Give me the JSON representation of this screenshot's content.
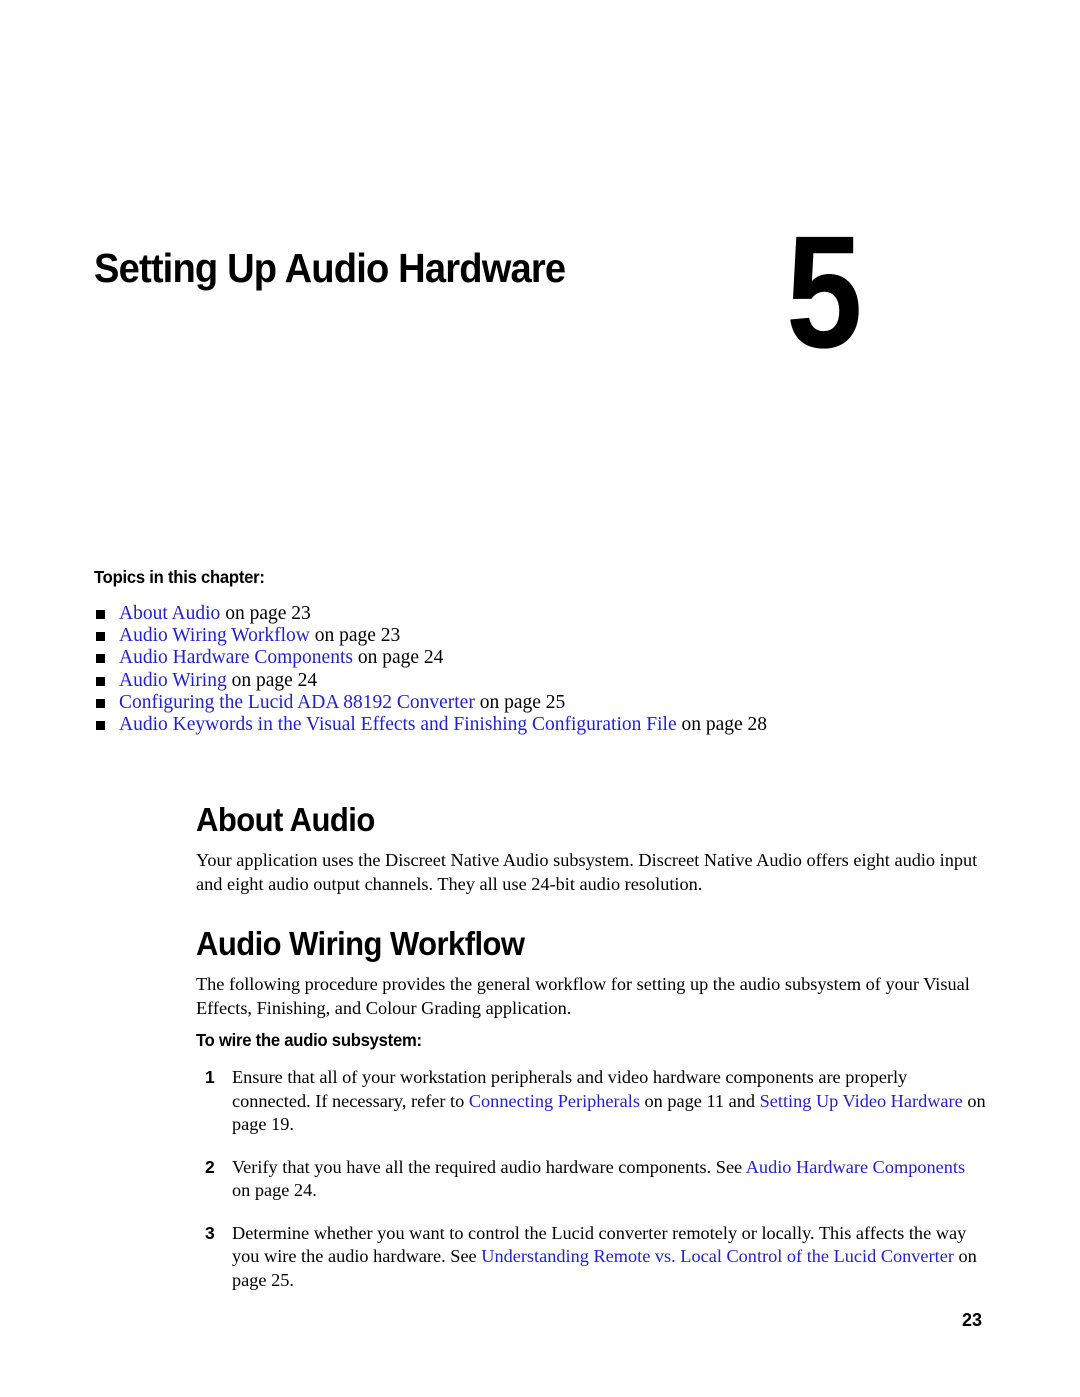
{
  "document": {
    "chapter_number": "5",
    "chapter_title": "Setting Up Audio Hardware",
    "page_number": "23",
    "link_color": "#2222cc",
    "text_color": "#000000",
    "background_color": "#ffffff"
  },
  "topics": {
    "heading": "Topics in this chapter:",
    "items": [
      {
        "link": "About Audio",
        "tail": " on page 23"
      },
      {
        "link": "Audio Wiring Workflow",
        "tail": " on page 23"
      },
      {
        "link": "Audio Hardware Components",
        "tail": " on page 24"
      },
      {
        "link": "Audio Wiring",
        "tail": " on page 24"
      },
      {
        "link": "Configuring the Lucid ADA 88192 Converter",
        "tail": " on page 25"
      },
      {
        "link": "Audio Keywords in the Visual Effects and Finishing Configuration File",
        "tail": " on page 28"
      }
    ]
  },
  "about_audio": {
    "heading": "About Audio",
    "paragraph": "Your application uses the Discreet Native Audio subsystem. Discreet Native Audio offers eight audio input and eight audio output channels. They all use 24-bit audio resolution."
  },
  "audio_wiring_workflow": {
    "heading": "Audio Wiring Workflow",
    "paragraph": "The following procedure provides the general workflow for setting up the audio subsystem of your Visual Effects, Finishing, and Colour Grading application.",
    "procedure_heading": "To wire the audio subsystem:",
    "steps": [
      {
        "number": "1",
        "part1": "Ensure that all of your workstation peripherals and video hardware components are properly connected. If necessary, refer to ",
        "link1": "Connecting Peripherals",
        "part2": " on page 11 and ",
        "link2": "Setting Up Video Hardware",
        "part3": " on page 19."
      },
      {
        "number": "2",
        "part1": "Verify that you have all the required audio hardware components. See ",
        "link1": "Audio Hardware Components",
        "part2": " on page 24.",
        "link2": "",
        "part3": ""
      },
      {
        "number": "3",
        "part1": "Determine whether you want to control the Lucid converter remotely or locally. This affects the way you wire the audio hardware. See ",
        "link1": "Understanding Remote vs. Local Control of the Lucid Converter",
        "part2": " on page 25.",
        "link2": "",
        "part3": ""
      }
    ]
  }
}
